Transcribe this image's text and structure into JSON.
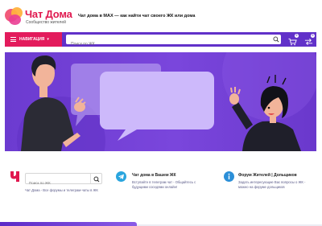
{
  "brand": {
    "title": "Чат Дома",
    "subtitle": "Сообщество жителей"
  },
  "header": {
    "headline": "Чат дома в MAX — как найти чат своего ЖК или дома"
  },
  "navbar": {
    "nav_label": "НАВИГАЦИЯ",
    "search_placeholder": "Поиск по ЖК",
    "cart_count": "0",
    "compare_count": "0"
  },
  "cards": {
    "search_placeholder": "Поиск по ЖК",
    "search_desc": "Чат Дома - Все форумы и телеграм-чаты в ЖК",
    "telegram_title": "Чат дома в Вашем ЖК",
    "telegram_desc": "Вступайте в телеграм чат - Общайтесь с будущими соседями онлайн!",
    "forum_title": "Форум Жителей | Дольщиков",
    "forum_desc": "Задать интересующие Вас вопросы о ЖК - можно на форуме дольщиков"
  },
  "colors": {
    "brand_red": "#e0184f",
    "nav_purple": "#6131c9",
    "hero_purple": "#7a46dc"
  },
  "icons": {
    "search": "search-icon",
    "cart": "cart-icon",
    "compare": "compare-icon",
    "telegram": "telegram-icon",
    "info": "info-icon"
  }
}
